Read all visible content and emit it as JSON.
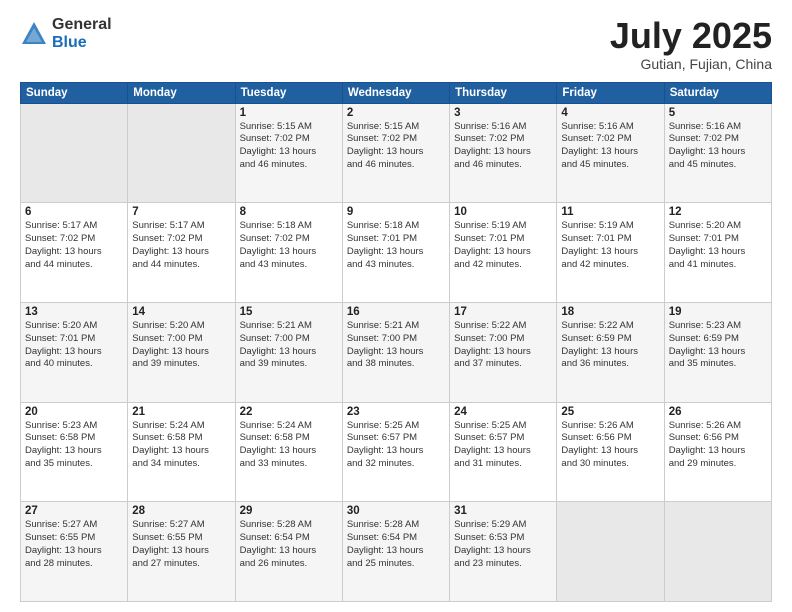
{
  "header": {
    "logo_general": "General",
    "logo_blue": "Blue",
    "title": "July 2025",
    "location": "Gutian, Fujian, China"
  },
  "weekdays": [
    "Sunday",
    "Monday",
    "Tuesday",
    "Wednesday",
    "Thursday",
    "Friday",
    "Saturday"
  ],
  "weeks": [
    [
      {
        "day": "",
        "info": ""
      },
      {
        "day": "",
        "info": ""
      },
      {
        "day": "1",
        "info": "Sunrise: 5:15 AM\nSunset: 7:02 PM\nDaylight: 13 hours\nand 46 minutes."
      },
      {
        "day": "2",
        "info": "Sunrise: 5:15 AM\nSunset: 7:02 PM\nDaylight: 13 hours\nand 46 minutes."
      },
      {
        "day": "3",
        "info": "Sunrise: 5:16 AM\nSunset: 7:02 PM\nDaylight: 13 hours\nand 46 minutes."
      },
      {
        "day": "4",
        "info": "Sunrise: 5:16 AM\nSunset: 7:02 PM\nDaylight: 13 hours\nand 45 minutes."
      },
      {
        "day": "5",
        "info": "Sunrise: 5:16 AM\nSunset: 7:02 PM\nDaylight: 13 hours\nand 45 minutes."
      }
    ],
    [
      {
        "day": "6",
        "info": "Sunrise: 5:17 AM\nSunset: 7:02 PM\nDaylight: 13 hours\nand 44 minutes."
      },
      {
        "day": "7",
        "info": "Sunrise: 5:17 AM\nSunset: 7:02 PM\nDaylight: 13 hours\nand 44 minutes."
      },
      {
        "day": "8",
        "info": "Sunrise: 5:18 AM\nSunset: 7:02 PM\nDaylight: 13 hours\nand 43 minutes."
      },
      {
        "day": "9",
        "info": "Sunrise: 5:18 AM\nSunset: 7:01 PM\nDaylight: 13 hours\nand 43 minutes."
      },
      {
        "day": "10",
        "info": "Sunrise: 5:19 AM\nSunset: 7:01 PM\nDaylight: 13 hours\nand 42 minutes."
      },
      {
        "day": "11",
        "info": "Sunrise: 5:19 AM\nSunset: 7:01 PM\nDaylight: 13 hours\nand 42 minutes."
      },
      {
        "day": "12",
        "info": "Sunrise: 5:20 AM\nSunset: 7:01 PM\nDaylight: 13 hours\nand 41 minutes."
      }
    ],
    [
      {
        "day": "13",
        "info": "Sunrise: 5:20 AM\nSunset: 7:01 PM\nDaylight: 13 hours\nand 40 minutes."
      },
      {
        "day": "14",
        "info": "Sunrise: 5:20 AM\nSunset: 7:00 PM\nDaylight: 13 hours\nand 39 minutes."
      },
      {
        "day": "15",
        "info": "Sunrise: 5:21 AM\nSunset: 7:00 PM\nDaylight: 13 hours\nand 39 minutes."
      },
      {
        "day": "16",
        "info": "Sunrise: 5:21 AM\nSunset: 7:00 PM\nDaylight: 13 hours\nand 38 minutes."
      },
      {
        "day": "17",
        "info": "Sunrise: 5:22 AM\nSunset: 7:00 PM\nDaylight: 13 hours\nand 37 minutes."
      },
      {
        "day": "18",
        "info": "Sunrise: 5:22 AM\nSunset: 6:59 PM\nDaylight: 13 hours\nand 36 minutes."
      },
      {
        "day": "19",
        "info": "Sunrise: 5:23 AM\nSunset: 6:59 PM\nDaylight: 13 hours\nand 35 minutes."
      }
    ],
    [
      {
        "day": "20",
        "info": "Sunrise: 5:23 AM\nSunset: 6:58 PM\nDaylight: 13 hours\nand 35 minutes."
      },
      {
        "day": "21",
        "info": "Sunrise: 5:24 AM\nSunset: 6:58 PM\nDaylight: 13 hours\nand 34 minutes."
      },
      {
        "day": "22",
        "info": "Sunrise: 5:24 AM\nSunset: 6:58 PM\nDaylight: 13 hours\nand 33 minutes."
      },
      {
        "day": "23",
        "info": "Sunrise: 5:25 AM\nSunset: 6:57 PM\nDaylight: 13 hours\nand 32 minutes."
      },
      {
        "day": "24",
        "info": "Sunrise: 5:25 AM\nSunset: 6:57 PM\nDaylight: 13 hours\nand 31 minutes."
      },
      {
        "day": "25",
        "info": "Sunrise: 5:26 AM\nSunset: 6:56 PM\nDaylight: 13 hours\nand 30 minutes."
      },
      {
        "day": "26",
        "info": "Sunrise: 5:26 AM\nSunset: 6:56 PM\nDaylight: 13 hours\nand 29 minutes."
      }
    ],
    [
      {
        "day": "27",
        "info": "Sunrise: 5:27 AM\nSunset: 6:55 PM\nDaylight: 13 hours\nand 28 minutes."
      },
      {
        "day": "28",
        "info": "Sunrise: 5:27 AM\nSunset: 6:55 PM\nDaylight: 13 hours\nand 27 minutes."
      },
      {
        "day": "29",
        "info": "Sunrise: 5:28 AM\nSunset: 6:54 PM\nDaylight: 13 hours\nand 26 minutes."
      },
      {
        "day": "30",
        "info": "Sunrise: 5:28 AM\nSunset: 6:54 PM\nDaylight: 13 hours\nand 25 minutes."
      },
      {
        "day": "31",
        "info": "Sunrise: 5:29 AM\nSunset: 6:53 PM\nDaylight: 13 hours\nand 23 minutes."
      },
      {
        "day": "",
        "info": ""
      },
      {
        "day": "",
        "info": ""
      }
    ]
  ]
}
